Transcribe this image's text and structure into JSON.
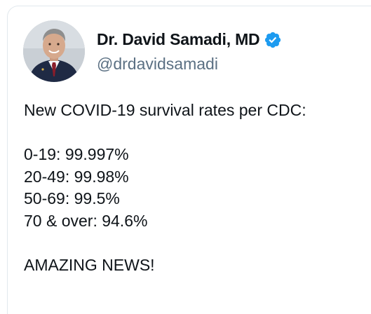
{
  "tweet": {
    "author": {
      "display_name": "Dr. David Samadi, MD",
      "handle": "@drdavidsamadi",
      "verified": true
    },
    "text": {
      "intro": "New COVID-19 survival rates per CDC:",
      "rates": [
        "0-19: 99.997%",
        "20-49: 99.98%",
        "50-69: 99.5%",
        "70 & over: 94.6%"
      ],
      "closing": "AMAZING NEWS!"
    }
  },
  "colors": {
    "text": "#0f1419",
    "handle": "#5b7083",
    "verified_badge": "#1d9bf0",
    "card_border": "#e1e8ed"
  },
  "icons": {
    "verified": "verified-badge-icon"
  }
}
